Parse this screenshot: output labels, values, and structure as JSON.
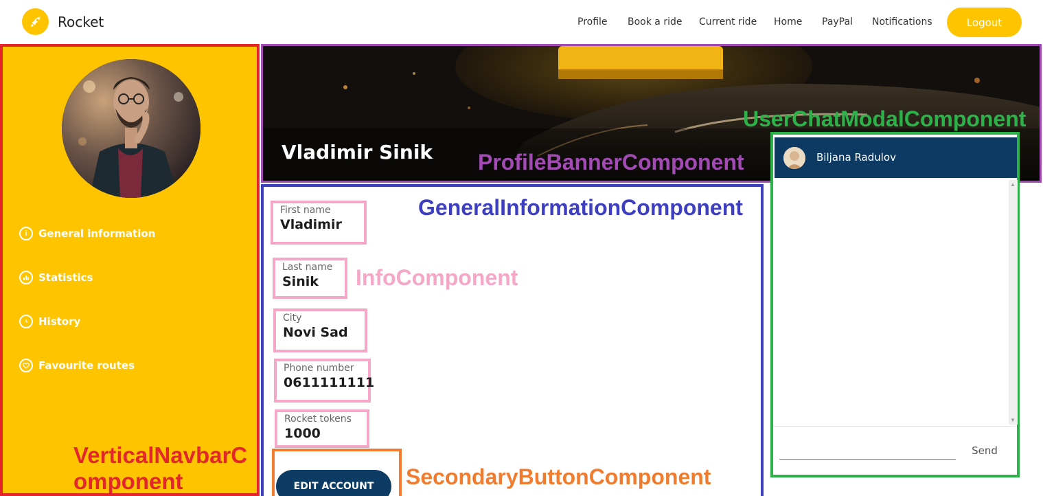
{
  "topbar": {
    "brand": "Rocket",
    "links": [
      "Profile",
      "Book a ride",
      "Current ride",
      "Home",
      "PayPal",
      "Notifications"
    ],
    "logout": "Logout"
  },
  "sidebar": {
    "items": [
      {
        "label": "General information",
        "icon": "info-icon"
      },
      {
        "label": "Statistics",
        "icon": "chart-icon"
      },
      {
        "label": "History",
        "icon": "history-icon"
      },
      {
        "label": "Favourite routes",
        "icon": "heart-icon"
      }
    ]
  },
  "banner": {
    "name": "Vladimir Sinik"
  },
  "info": [
    {
      "label": "First name",
      "value": "Vladimir"
    },
    {
      "label": "Last name",
      "value": "Sinik"
    },
    {
      "label": "City",
      "value": "Novi Sad"
    },
    {
      "label": "Phone number",
      "value": "0611111111"
    },
    {
      "label": "Rocket tokens",
      "value": "1000"
    }
  ],
  "edit_button": "EDIT ACCOUNT",
  "chat": {
    "user": "Biljana Radulov",
    "input_value": "",
    "send": "Send"
  },
  "annotations": {
    "vertical_navbar": "VerticalNavbarC",
    "vertical_navbar2": "omponent",
    "profile_banner": "ProfileBannerComponent",
    "general_info": "GeneralInformationComponent",
    "info": "InfoComponent",
    "secondary_button": "SecondaryButtonComponent",
    "user_chat": "UserChatModalComponent"
  },
  "colors": {
    "accent": "#ffc400",
    "navbar_border": "#e3262a",
    "banner_border": "#a24bb5",
    "general_border": "#3d3fc0",
    "info_border": "#f4a7c7",
    "button_border": "#f07c30",
    "chat_border": "#2db24a",
    "dark_blue": "#0c3c63"
  }
}
